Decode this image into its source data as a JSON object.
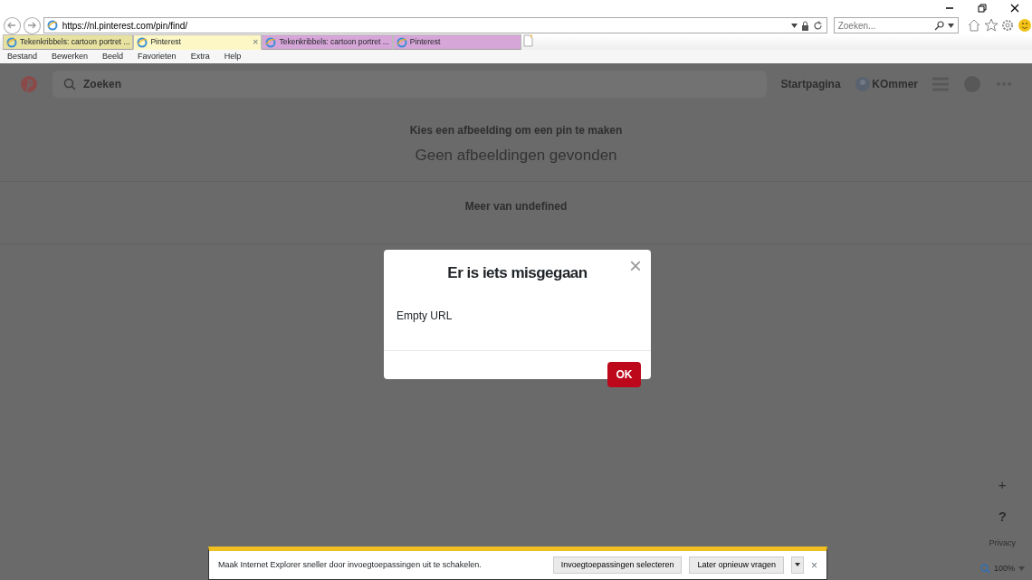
{
  "browser": {
    "address": "https://nl.pinterest.com/pin/find/",
    "search": {
      "placeholder": "Zoeken..."
    },
    "tabs": [
      {
        "label": "Tekenkribbels: cartoon portret ...",
        "selected": false,
        "color": "#e8e2a0"
      },
      {
        "label": "Pinterest",
        "selected": true,
        "color": "#fcf7c4"
      },
      {
        "label": "Tekenkribbels: cartoon portret ...",
        "selected": false,
        "color": "#d6a6d8"
      },
      {
        "label": "Pinterest",
        "selected": false,
        "color": "#d6a6d8"
      }
    ],
    "close_tab": "×",
    "menu": [
      "Bestand",
      "Bewerken",
      "Beeld",
      "Favorieten",
      "Extra",
      "Help"
    ]
  },
  "page": {
    "search": {
      "placeholder": "Zoeken"
    },
    "nav": [
      "Startpagina",
      "KOmmer"
    ],
    "heading": "Kies een afbeelding om een pin te maken",
    "empty": "Geen afbeeldingen gevonden",
    "more": "Meer van undefined",
    "plus": "+",
    "help": "?",
    "privacy": "Privacy"
  },
  "dialog": {
    "title": "Er is iets misgegaan",
    "close": "×",
    "message": "Empty URL",
    "button": "OK"
  },
  "notification": {
    "message": "Maak Internet Explorer sneller door invoegtoepassingen uit te schakelen.",
    "buttons": [
      "Invoegtoepassingen selecteren",
      "Later opnieuw vragen"
    ],
    "close": "×"
  },
  "status_bar": {
    "zoom": "100%"
  }
}
